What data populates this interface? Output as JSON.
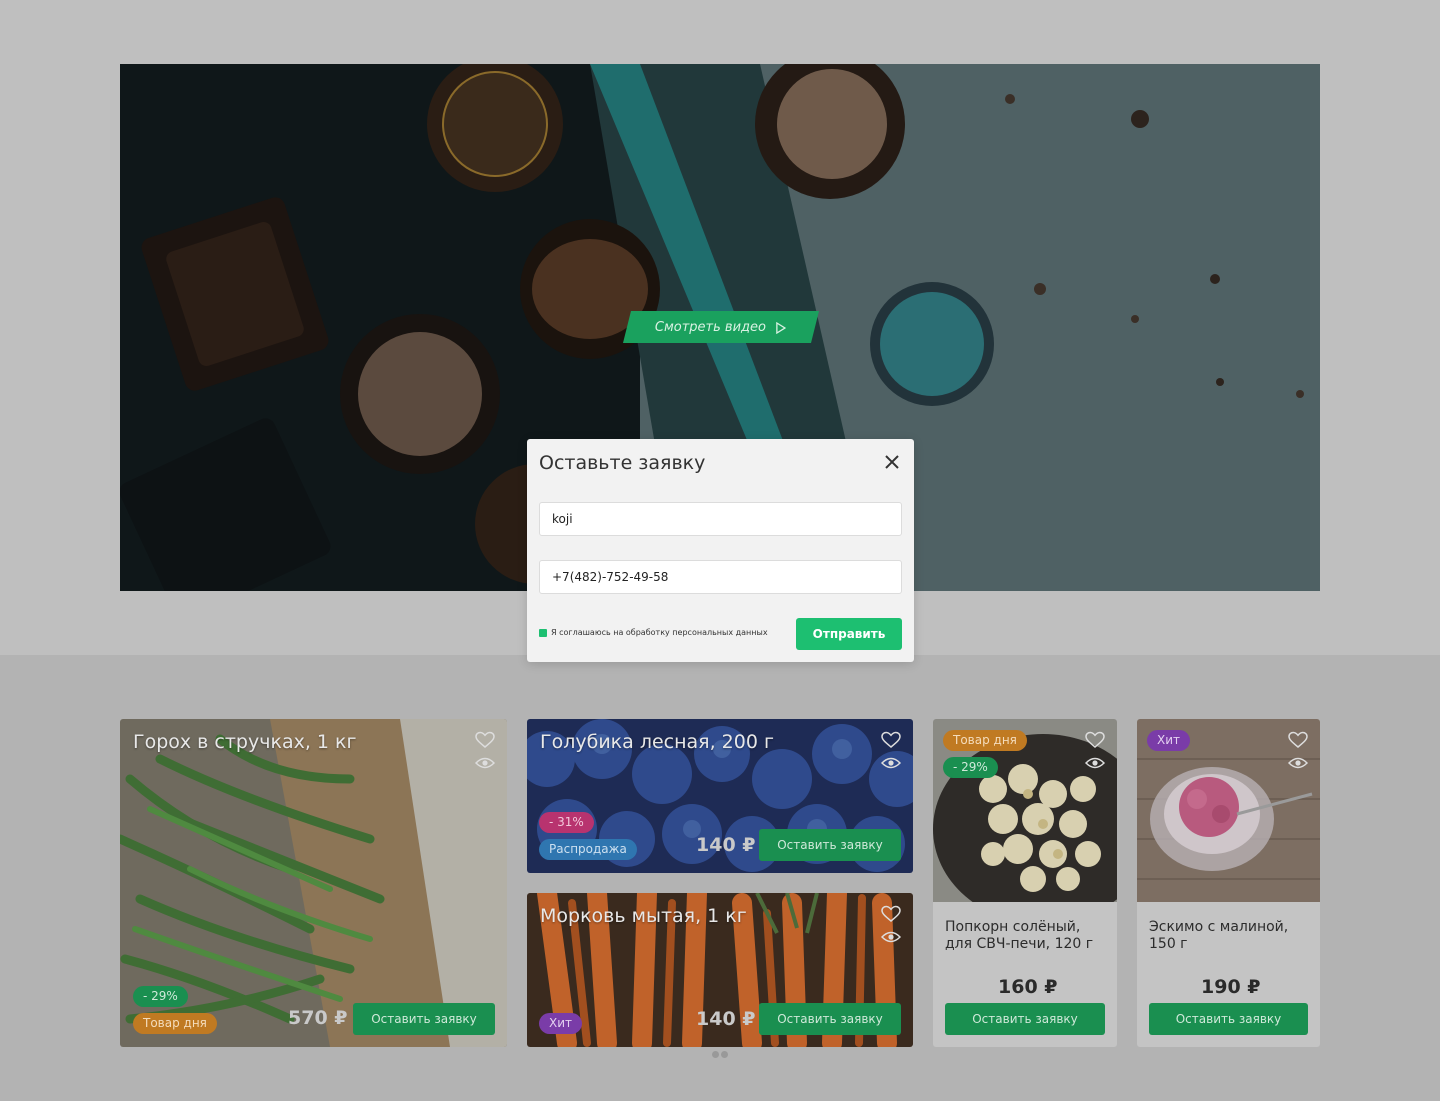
{
  "hero": {
    "video_button_label": "Смотреть видео"
  },
  "modal": {
    "title": "Оставьте заявку",
    "name_value": "koji",
    "phone_value": "+7(482)-752-49-58",
    "consent_label": "Я соглашаюсь на обработку персональных данных",
    "consent_checked": true,
    "submit_label": "Отправить"
  },
  "products": [
    {
      "title": "Горох в стручках, 1 кг",
      "badges": [
        "- 29%",
        "Товар дня"
      ],
      "price": "570 ₽",
      "button_label": "Оставить заявку"
    },
    {
      "title": "Голубика лесная, 200 г",
      "badges": [
        "- 31%",
        "Распродажа"
      ],
      "price": "140 ₽",
      "button_label": "Оставить заявку"
    },
    {
      "title": "Морковь мытая, 1 кг",
      "badges": [
        "Хит"
      ],
      "price": "140 ₽",
      "button_label": "Оставить заявку"
    },
    {
      "title": "Попкорн солёный, для СВЧ-печи, 120 г",
      "badges": [
        "Товар дня",
        "- 29%"
      ],
      "price": "160 ₽",
      "button_label": "Оставить заявку"
    },
    {
      "title": "Эскимо с малиной, 150 г",
      "badges": [
        "Хит"
      ],
      "price": "190 ₽",
      "button_label": "Оставить заявку"
    }
  ],
  "colors": {
    "accent_green": "#1dbf71",
    "dim_green": "#1a8f50",
    "overlay_gray": "#bfbfbf"
  },
  "icons": [
    "play-icon",
    "close-icon",
    "heart-icon",
    "eye-icon"
  ]
}
